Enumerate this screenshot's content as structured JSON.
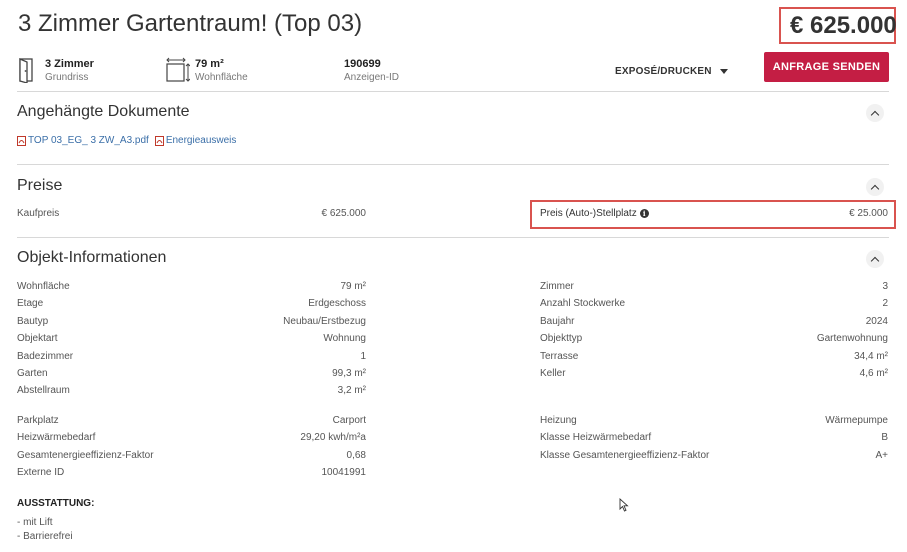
{
  "header": {
    "title": "3 Zimmer Gartentraum! (Top 03)",
    "price": "€ 625.000"
  },
  "facts": [
    {
      "value": "3 Zimmer",
      "label": "Grundriss",
      "icon": "door-icon"
    },
    {
      "value": "79 m²",
      "label": "Wohnfläche",
      "icon": "area-icon"
    },
    {
      "value": "190699",
      "label": "Anzeigen-ID",
      "icon": ""
    }
  ],
  "actions": {
    "expose_label": "EXPOSÉ/DRUCKEN",
    "send_label": "ANFRAGE SENDEN"
  },
  "documents": {
    "title": "Angehängte Dokumente",
    "files": [
      "TOP 03_EG_ 3 ZW_A3.pdf",
      "Energieausweis"
    ]
  },
  "prices": {
    "title": "Preise",
    "purchase_label": "Kaufpreis",
    "purchase_value": "€ 625.000",
    "parking_label": "Preis (Auto-)Stellplatz",
    "parking_value": "€ 25.000"
  },
  "object_info": {
    "title": "Objekt-Informationen",
    "left": [
      {
        "label": "Wohnfläche",
        "value": "79 m²"
      },
      {
        "label": "Etage",
        "value": "Erdgeschoss"
      },
      {
        "label": "Bautyp",
        "value": "Neubau/Erstbezug"
      },
      {
        "label": "Objektart",
        "value": "Wohnung"
      },
      {
        "label": "Badezimmer",
        "value": "1"
      },
      {
        "label": "Garten",
        "value": "99,3 m²"
      },
      {
        "label": "Abstellraum",
        "value": "3,2 m²"
      }
    ],
    "right": [
      {
        "label": "Zimmer",
        "value": "3"
      },
      {
        "label": "Anzahl Stockwerke",
        "value": "2"
      },
      {
        "label": "Baujahr",
        "value": "2024"
      },
      {
        "label": "Objekttyp",
        "value": "Gartenwohnung"
      },
      {
        "label": "Terrasse",
        "value": "34,4 m²"
      },
      {
        "label": "Keller",
        "value": "4,6 m²"
      }
    ],
    "left2": [
      {
        "label": "Parkplatz",
        "value": "Carport"
      },
      {
        "label": "Heizwärmebedarf",
        "value": "29,20 kwh/m²a"
      },
      {
        "label": "Gesamtenergieeffizienz-Faktor",
        "value": "0,68"
      },
      {
        "label": "Externe ID",
        "value": "10041991"
      }
    ],
    "right2": [
      {
        "label": "Heizung",
        "value": "Wärmepumpe"
      },
      {
        "label": "Klasse Heizwärmebedarf",
        "value": "B"
      },
      {
        "label": "Klasse Gesamtenergieeffizienz-Faktor",
        "value": "A+"
      }
    ]
  },
  "equipment": {
    "title": "AUSSTATTUNG:",
    "items": [
      "- mit Lift",
      "- Barrierefrei"
    ]
  }
}
